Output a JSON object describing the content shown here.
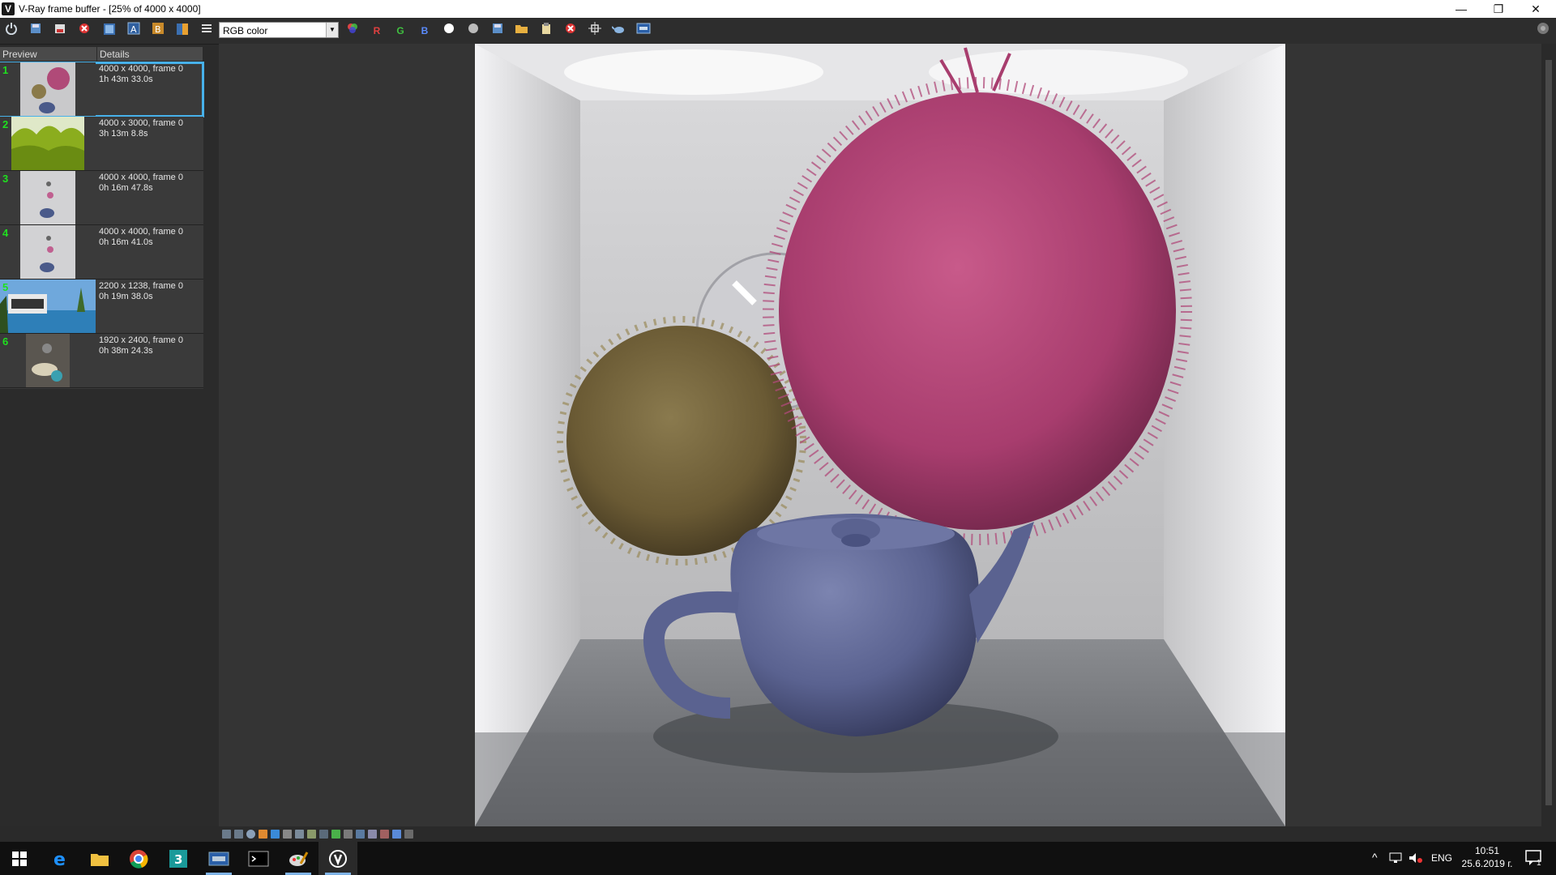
{
  "window": {
    "title": "V-Ray frame buffer - [25% of 4000 x 4000]",
    "app_icon": "V",
    "minimize": "—",
    "restore": "❐",
    "close": "✕"
  },
  "toolbar": {
    "channel": "RGB color",
    "r_label": "R",
    "g_label": "G",
    "b_label": "B"
  },
  "history": {
    "col_preview": "Preview",
    "col_details": "Details",
    "items": [
      {
        "num": "1",
        "line1": "4000 x 4000, frame 0",
        "line2": "1h 43m 33.0s"
      },
      {
        "num": "2",
        "line1": "4000 x 3000, frame 0",
        "line2": "3h 13m 8.8s"
      },
      {
        "num": "3",
        "line1": "4000 x 4000, frame 0",
        "line2": "0h 16m 47.8s"
      },
      {
        "num": "4",
        "line1": "4000 x 4000, frame 0",
        "line2": "0h 16m 41.0s"
      },
      {
        "num": "5",
        "line1": "2200 x 1238, frame 0",
        "line2": "0h 19m 38.0s"
      },
      {
        "num": "6",
        "line1": "1920 x 2400, frame 0",
        "line2": "0h 38m 24.3s"
      }
    ]
  },
  "taskbar": {
    "lang": "ENG",
    "time": "10:51",
    "date": "25.6.2019 г.",
    "notif_count": "1"
  },
  "colors": {
    "accent": "#47b1ea",
    "history_num": "#1fe01f"
  }
}
